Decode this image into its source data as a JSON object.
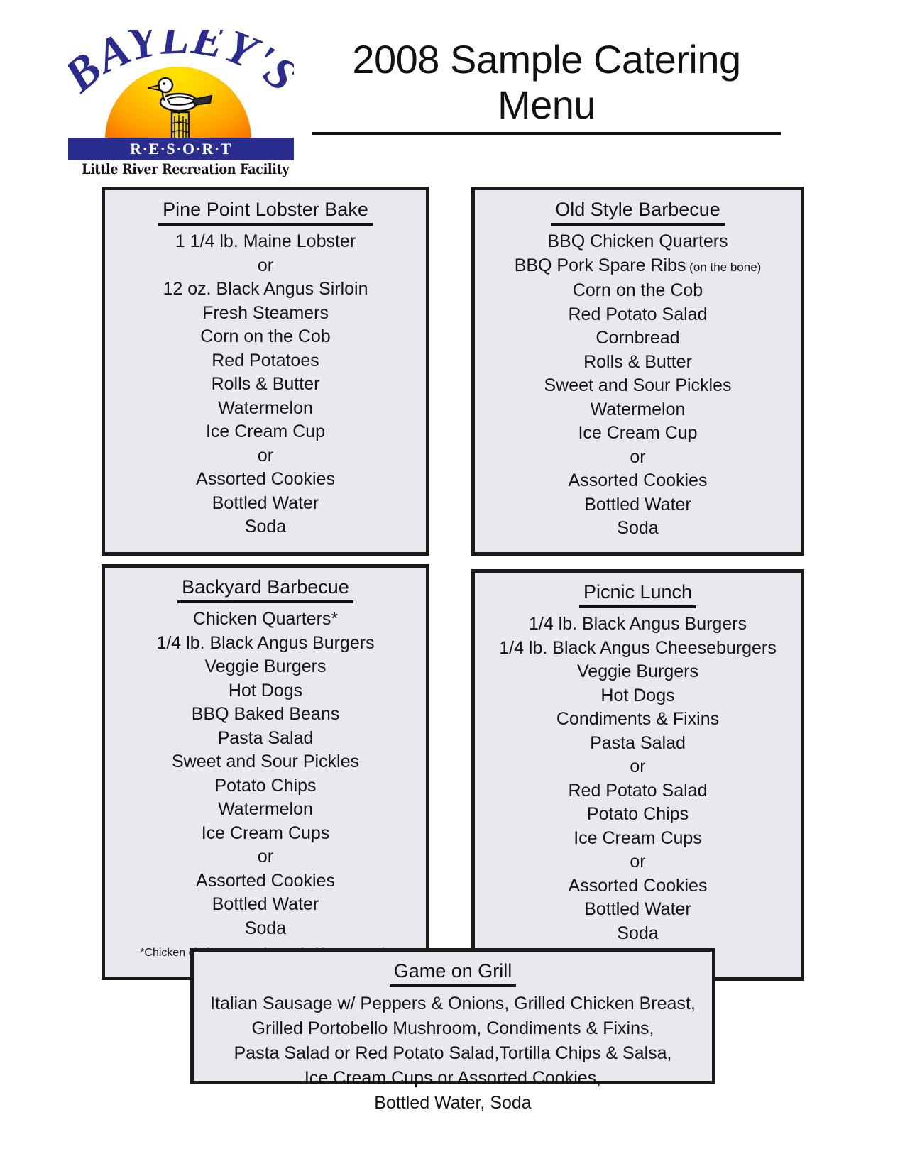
{
  "logo": {
    "wordmark": "BAYLEY'S",
    "resort_bar": "R·E·S·O·R·T",
    "tagline": "Little River Recreation Facility",
    "colors": {
      "wordmark_blue": "#2b2d8e",
      "sun_top": "#ffe400",
      "sun_bottom": "#d8420a",
      "bar_blue": "#2b2d8e"
    }
  },
  "title": {
    "line1": "2008 Sample Catering",
    "line2": "Menu"
  },
  "panels": [
    {
      "id": "lobster",
      "title": "Pine Point Lobster Bake",
      "items": [
        "1 1/4 lb. Maine Lobster",
        "or",
        "12 oz. Black Angus Sirloin",
        "Fresh Steamers",
        "Corn on the Cob",
        "Red Potatoes",
        "Rolls & Butter",
        "Watermelon",
        "Ice Cream Cup",
        "or",
        "Assorted Cookies",
        "Bottled Water",
        "Soda"
      ],
      "footnote": ""
    },
    {
      "id": "oldstyle",
      "title": "Old Style Barbecue",
      "items": [
        "BBQ Chicken Quarters",
        "BBQ Pork Spare Ribs (on the bone)",
        "Corn on the Cob",
        "Red Potato Salad",
        "Cornbread",
        "Rolls & Butter",
        "Sweet and Sour Pickles",
        "Watermelon",
        "Ice Cream Cup",
        "or",
        "Assorted Cookies",
        "Bottled Water",
        "Soda"
      ],
      "footnote": ""
    },
    {
      "id": "backyard",
      "title": "Backyard Barbecue",
      "items": [
        "Chicken Quarters*",
        "1/4 lb. Black Angus Burgers",
        "Veggie Burgers",
        "Hot Dogs",
        "BBQ Baked Beans",
        "Pasta Salad",
        "Sweet and Sour Pickles",
        "Potato Chips",
        "Watermelon",
        "Ice Cream Cups",
        "or",
        "Assorted Cookies",
        "Bottled Water",
        "Soda"
      ],
      "footnote": "*Chicken choices are Cajun, Teriyaki or BBQ style"
    },
    {
      "id": "picnic",
      "title": "Picnic Lunch",
      "items": [
        "1/4 lb.  Black Angus Burgers",
        "1/4 lb. Black Angus Cheeseburgers",
        "Veggie Burgers",
        "Hot Dogs",
        "Condiments & Fixins",
        "Pasta Salad",
        "or",
        "Red Potato Salad",
        "Potato Chips",
        "Ice Cream Cups",
        "or",
        "Assorted Cookies",
        "Bottled Water",
        "Soda"
      ],
      "footnote": ""
    },
    {
      "id": "game",
      "title": "Game on Grill",
      "items": [
        "Italian Sausage w/ Peppers & Onions, Grilled Chicken Breast,",
        "Grilled Portobello Mushroom, Condiments & Fixins,",
        "Pasta Salad or Red Potato Salad,Tortilla Chips & Salsa,",
        "Ice Cream Cups or Assorted Cookies,",
        "Bottled Water, Soda"
      ],
      "footnote": ""
    }
  ]
}
